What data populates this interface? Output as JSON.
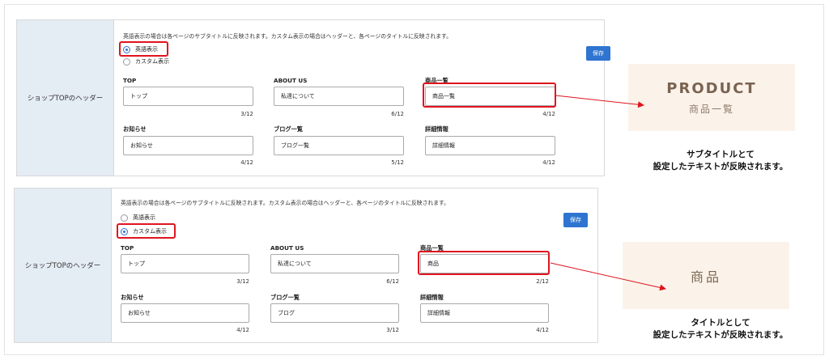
{
  "panels": [
    {
      "side_label": "ショップTOPのヘッダー",
      "description": "英語表示の場合は各ページのサブタイトルに反映されます。カスタム表示の場合はヘッダーと、各ページのタイトルに反映されます。",
      "radio_english": "英語表示",
      "radio_custom": "カスタム表示",
      "selected": "english",
      "save_label": "保存",
      "fields": [
        {
          "label": "TOP",
          "value": "トップ",
          "count": "3/12"
        },
        {
          "label": "ABOUT US",
          "value": "私達について",
          "count": "6/12"
        },
        {
          "label": "商品一覧",
          "value": "商品一覧",
          "count": "4/12"
        },
        {
          "label": "お知らせ",
          "value": "お知らせ",
          "count": "4/12"
        },
        {
          "label": "ブログ一覧",
          "value": "ブログ一覧",
          "count": "5/12"
        },
        {
          "label": "詳細情報",
          "value": "詳細情報",
          "count": "4/12"
        }
      ]
    },
    {
      "side_label": "ショップTOPのヘッダー",
      "description": "英語表示の場合は各ページのサブタイトルに反映されます。カスタム表示の場合はヘッダーと、各ページのタイトルに反映されます。",
      "radio_english": "英語表示",
      "radio_custom": "カスタム表示",
      "selected": "custom",
      "save_label": "保存",
      "fields": [
        {
          "label": "TOP",
          "value": "トップ",
          "count": "3/12"
        },
        {
          "label": "ABOUT US",
          "value": "私達について",
          "count": "6/12"
        },
        {
          "label": "商品一覧",
          "value": "商品",
          "count": "2/12"
        },
        {
          "label": "お知らせ",
          "value": "お知らせ",
          "count": "4/12"
        },
        {
          "label": "ブログ一覧",
          "value": "ブログ",
          "count": "3/12"
        },
        {
          "label": "詳細情報",
          "value": "詳細情報",
          "count": "4/12"
        }
      ]
    }
  ],
  "preview1": {
    "title": "PRODUCT",
    "subtitle": "商品一覧"
  },
  "caption1": {
    "line1": "サブタイトルとて",
    "line2": "設定したテキストが反映されます。"
  },
  "preview2": {
    "title": "商品"
  },
  "caption2": {
    "line1": "タイトルとして",
    "line2": "設定したテキストが反映されます。"
  },
  "colors": {
    "accent": "#2f74d0",
    "highlight": "#e0141e",
    "side_bg": "#e4ecf4",
    "card_bg": "#fbf3ea"
  }
}
